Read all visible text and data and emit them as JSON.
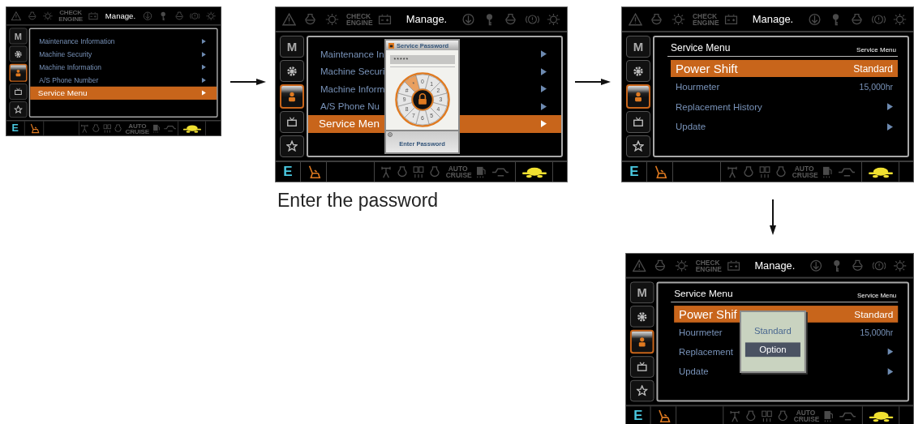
{
  "screens": [
    {
      "top_title": "Manage.",
      "engine_label": "CHECK ENGINE",
      "mode_letter": "E",
      "cruise_label": "AUTO CRUISE",
      "side_tabs": [
        {
          "label": "M",
          "selected": false
        },
        {
          "selected": false
        },
        {
          "selected": true
        },
        {
          "selected": false
        },
        {
          "selected": false
        }
      ],
      "panel": {
        "kind": "menu",
        "items": [
          {
            "label": "Maintenance Information",
            "arrow": true,
            "selected": false
          },
          {
            "label": "Machine Security",
            "arrow": true,
            "selected": false
          },
          {
            "label": "Machine Information",
            "arrow": true,
            "selected": false
          },
          {
            "label": "A/S Phone Number",
            "arrow": true,
            "selected": false
          },
          {
            "label": "Service Menu",
            "arrow": true,
            "selected": true
          }
        ]
      }
    },
    {
      "top_title": "Manage.",
      "engine_label": "CHECK ENGINE",
      "mode_letter": "E",
      "cruise_label": "AUTO CRUISE",
      "side_tabs": [
        {
          "label": "M",
          "selected": false
        },
        {
          "selected": false
        },
        {
          "selected": true
        },
        {
          "selected": false
        },
        {
          "selected": false
        }
      ],
      "panel": {
        "kind": "menu",
        "items": [
          {
            "label": "Maintenance In",
            "arrow": true,
            "selected": false
          },
          {
            "label": "Machine Securi",
            "arrow": true,
            "selected": false
          },
          {
            "label": "Machine Inform",
            "arrow": true,
            "selected": false
          },
          {
            "label": "A/S Phone Nu",
            "arrow": true,
            "selected": false
          },
          {
            "label": "Service Men",
            "arrow": true,
            "selected": true
          }
        ]
      },
      "dialog": {
        "kind": "password",
        "title": "Service Password",
        "value": "*****",
        "keys": [
          {
            "label": "*",
            "selected": true
          },
          {
            "label": "0",
            "selected": false
          },
          {
            "label": "1",
            "selected": false
          },
          {
            "label": "2",
            "selected": false
          },
          {
            "label": "3",
            "selected": false
          },
          {
            "label": "4",
            "selected": false
          },
          {
            "label": "5",
            "selected": false
          },
          {
            "label": "6",
            "selected": false
          },
          {
            "label": "7",
            "selected": false
          },
          {
            "label": "8",
            "selected": false
          },
          {
            "label": "9",
            "selected": false
          },
          {
            "label": "#",
            "selected": false
          }
        ],
        "hint": "Enter Password"
      }
    },
    {
      "top_title": "Manage.",
      "engine_label": "CHECK ENGINE",
      "mode_letter": "E",
      "cruise_label": "AUTO CRUISE",
      "side_tabs": [
        {
          "label": "M",
          "selected": false
        },
        {
          "selected": false
        },
        {
          "selected": true
        },
        {
          "selected": false
        },
        {
          "selected": false
        }
      ],
      "panel": {
        "kind": "service",
        "title": "Service Menu",
        "breadcrumb": "Service Menu",
        "items": [
          {
            "label": "Power Shift",
            "value": "Standard",
            "selected": true
          },
          {
            "label": "Hourmeter",
            "value": "15,000hr",
            "selected": false
          },
          {
            "label": "Replacement History",
            "arrow": true,
            "selected": false
          },
          {
            "label": "Update",
            "arrow": true,
            "selected": false
          }
        ]
      }
    },
    {
      "top_title": "Manage.",
      "engine_label": "CHECK ENGINE",
      "mode_letter": "E",
      "cruise_label": "AUTO CRUISE",
      "side_tabs": [
        {
          "label": "M",
          "selected": false
        },
        {
          "selected": false
        },
        {
          "selected": true
        },
        {
          "selected": false
        },
        {
          "selected": false
        }
      ],
      "panel": {
        "kind": "service",
        "title": "Service Menu",
        "breadcrumb": "Service Menu",
        "items": [
          {
            "label": "Power Shif",
            "value": "Standard",
            "selected": true
          },
          {
            "label": "Hourmeter",
            "value": "15,000hr",
            "selected": false
          },
          {
            "label": "Replacement",
            "arrow": true,
            "selected": false
          },
          {
            "label": "Update",
            "arrow": true,
            "selected": false
          }
        ]
      },
      "dialog": {
        "kind": "choice",
        "options": [
          {
            "label": "Standard",
            "selected": false
          },
          {
            "label": "Option",
            "selected": true
          }
        ]
      }
    }
  ],
  "caption": "Enter the password"
}
